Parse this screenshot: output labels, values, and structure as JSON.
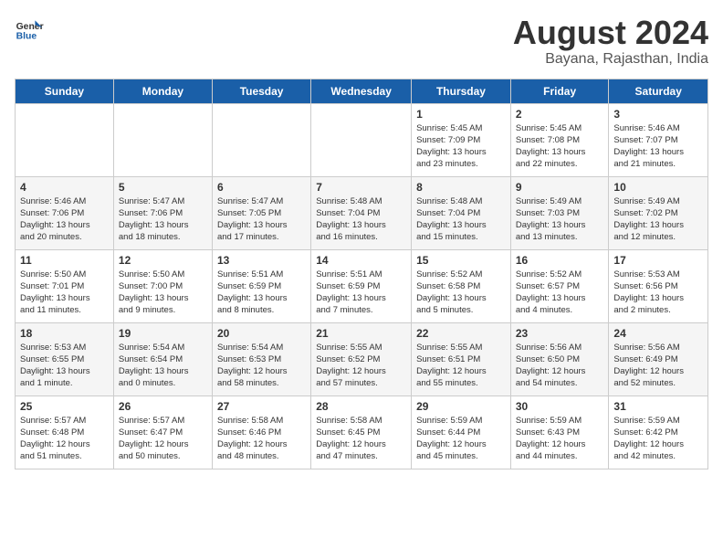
{
  "header": {
    "logo_line1": "General",
    "logo_line2": "Blue",
    "title": "August 2024",
    "subtitle": "Bayana, Rajasthan, India"
  },
  "days_of_week": [
    "Sunday",
    "Monday",
    "Tuesday",
    "Wednesday",
    "Thursday",
    "Friday",
    "Saturday"
  ],
  "weeks": [
    [
      {
        "day": "",
        "info": ""
      },
      {
        "day": "",
        "info": ""
      },
      {
        "day": "",
        "info": ""
      },
      {
        "day": "",
        "info": ""
      },
      {
        "day": "1",
        "info": "Sunrise: 5:45 AM\nSunset: 7:09 PM\nDaylight: 13 hours\nand 23 minutes."
      },
      {
        "day": "2",
        "info": "Sunrise: 5:45 AM\nSunset: 7:08 PM\nDaylight: 13 hours\nand 22 minutes."
      },
      {
        "day": "3",
        "info": "Sunrise: 5:46 AM\nSunset: 7:07 PM\nDaylight: 13 hours\nand 21 minutes."
      }
    ],
    [
      {
        "day": "4",
        "info": "Sunrise: 5:46 AM\nSunset: 7:06 PM\nDaylight: 13 hours\nand 20 minutes."
      },
      {
        "day": "5",
        "info": "Sunrise: 5:47 AM\nSunset: 7:06 PM\nDaylight: 13 hours\nand 18 minutes."
      },
      {
        "day": "6",
        "info": "Sunrise: 5:47 AM\nSunset: 7:05 PM\nDaylight: 13 hours\nand 17 minutes."
      },
      {
        "day": "7",
        "info": "Sunrise: 5:48 AM\nSunset: 7:04 PM\nDaylight: 13 hours\nand 16 minutes."
      },
      {
        "day": "8",
        "info": "Sunrise: 5:48 AM\nSunset: 7:04 PM\nDaylight: 13 hours\nand 15 minutes."
      },
      {
        "day": "9",
        "info": "Sunrise: 5:49 AM\nSunset: 7:03 PM\nDaylight: 13 hours\nand 13 minutes."
      },
      {
        "day": "10",
        "info": "Sunrise: 5:49 AM\nSunset: 7:02 PM\nDaylight: 13 hours\nand 12 minutes."
      }
    ],
    [
      {
        "day": "11",
        "info": "Sunrise: 5:50 AM\nSunset: 7:01 PM\nDaylight: 13 hours\nand 11 minutes."
      },
      {
        "day": "12",
        "info": "Sunrise: 5:50 AM\nSunset: 7:00 PM\nDaylight: 13 hours\nand 9 minutes."
      },
      {
        "day": "13",
        "info": "Sunrise: 5:51 AM\nSunset: 6:59 PM\nDaylight: 13 hours\nand 8 minutes."
      },
      {
        "day": "14",
        "info": "Sunrise: 5:51 AM\nSunset: 6:59 PM\nDaylight: 13 hours\nand 7 minutes."
      },
      {
        "day": "15",
        "info": "Sunrise: 5:52 AM\nSunset: 6:58 PM\nDaylight: 13 hours\nand 5 minutes."
      },
      {
        "day": "16",
        "info": "Sunrise: 5:52 AM\nSunset: 6:57 PM\nDaylight: 13 hours\nand 4 minutes."
      },
      {
        "day": "17",
        "info": "Sunrise: 5:53 AM\nSunset: 6:56 PM\nDaylight: 13 hours\nand 2 minutes."
      }
    ],
    [
      {
        "day": "18",
        "info": "Sunrise: 5:53 AM\nSunset: 6:55 PM\nDaylight: 13 hours\nand 1 minute."
      },
      {
        "day": "19",
        "info": "Sunrise: 5:54 AM\nSunset: 6:54 PM\nDaylight: 13 hours\nand 0 minutes."
      },
      {
        "day": "20",
        "info": "Sunrise: 5:54 AM\nSunset: 6:53 PM\nDaylight: 12 hours\nand 58 minutes."
      },
      {
        "day": "21",
        "info": "Sunrise: 5:55 AM\nSunset: 6:52 PM\nDaylight: 12 hours\nand 57 minutes."
      },
      {
        "day": "22",
        "info": "Sunrise: 5:55 AM\nSunset: 6:51 PM\nDaylight: 12 hours\nand 55 minutes."
      },
      {
        "day": "23",
        "info": "Sunrise: 5:56 AM\nSunset: 6:50 PM\nDaylight: 12 hours\nand 54 minutes."
      },
      {
        "day": "24",
        "info": "Sunrise: 5:56 AM\nSunset: 6:49 PM\nDaylight: 12 hours\nand 52 minutes."
      }
    ],
    [
      {
        "day": "25",
        "info": "Sunrise: 5:57 AM\nSunset: 6:48 PM\nDaylight: 12 hours\nand 51 minutes."
      },
      {
        "day": "26",
        "info": "Sunrise: 5:57 AM\nSunset: 6:47 PM\nDaylight: 12 hours\nand 50 minutes."
      },
      {
        "day": "27",
        "info": "Sunrise: 5:58 AM\nSunset: 6:46 PM\nDaylight: 12 hours\nand 48 minutes."
      },
      {
        "day": "28",
        "info": "Sunrise: 5:58 AM\nSunset: 6:45 PM\nDaylight: 12 hours\nand 47 minutes."
      },
      {
        "day": "29",
        "info": "Sunrise: 5:59 AM\nSunset: 6:44 PM\nDaylight: 12 hours\nand 45 minutes."
      },
      {
        "day": "30",
        "info": "Sunrise: 5:59 AM\nSunset: 6:43 PM\nDaylight: 12 hours\nand 44 minutes."
      },
      {
        "day": "31",
        "info": "Sunrise: 5:59 AM\nSunset: 6:42 PM\nDaylight: 12 hours\nand 42 minutes."
      }
    ]
  ]
}
